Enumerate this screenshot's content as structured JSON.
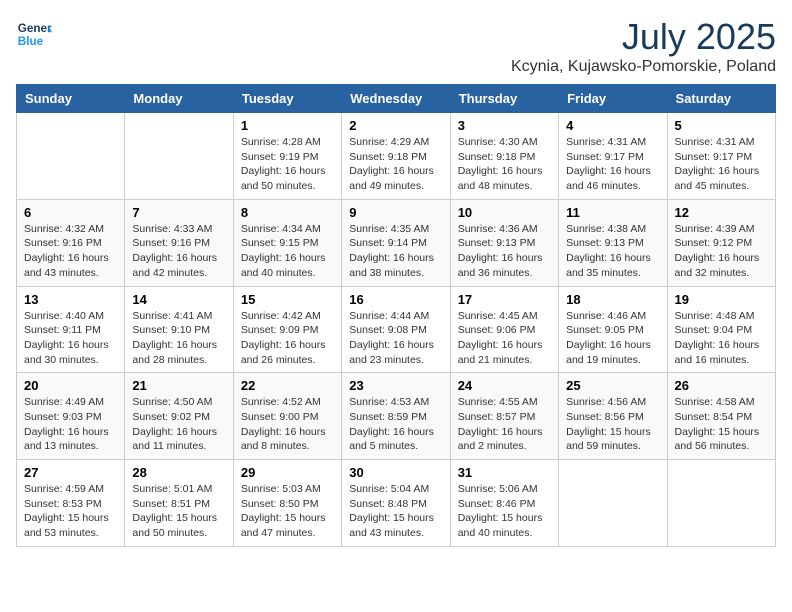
{
  "header": {
    "logo_line1": "General",
    "logo_line2": "Blue",
    "month": "July 2025",
    "location": "Kcynia, Kujawsko-Pomorskie, Poland"
  },
  "days_of_week": [
    "Sunday",
    "Monday",
    "Tuesday",
    "Wednesday",
    "Thursday",
    "Friday",
    "Saturday"
  ],
  "weeks": [
    [
      {
        "day": "",
        "info": ""
      },
      {
        "day": "",
        "info": ""
      },
      {
        "day": "1",
        "info": "Sunrise: 4:28 AM\nSunset: 9:19 PM\nDaylight: 16 hours\nand 50 minutes."
      },
      {
        "day": "2",
        "info": "Sunrise: 4:29 AM\nSunset: 9:18 PM\nDaylight: 16 hours\nand 49 minutes."
      },
      {
        "day": "3",
        "info": "Sunrise: 4:30 AM\nSunset: 9:18 PM\nDaylight: 16 hours\nand 48 minutes."
      },
      {
        "day": "4",
        "info": "Sunrise: 4:31 AM\nSunset: 9:17 PM\nDaylight: 16 hours\nand 46 minutes."
      },
      {
        "day": "5",
        "info": "Sunrise: 4:31 AM\nSunset: 9:17 PM\nDaylight: 16 hours\nand 45 minutes."
      }
    ],
    [
      {
        "day": "6",
        "info": "Sunrise: 4:32 AM\nSunset: 9:16 PM\nDaylight: 16 hours\nand 43 minutes."
      },
      {
        "day": "7",
        "info": "Sunrise: 4:33 AM\nSunset: 9:16 PM\nDaylight: 16 hours\nand 42 minutes."
      },
      {
        "day": "8",
        "info": "Sunrise: 4:34 AM\nSunset: 9:15 PM\nDaylight: 16 hours\nand 40 minutes."
      },
      {
        "day": "9",
        "info": "Sunrise: 4:35 AM\nSunset: 9:14 PM\nDaylight: 16 hours\nand 38 minutes."
      },
      {
        "day": "10",
        "info": "Sunrise: 4:36 AM\nSunset: 9:13 PM\nDaylight: 16 hours\nand 36 minutes."
      },
      {
        "day": "11",
        "info": "Sunrise: 4:38 AM\nSunset: 9:13 PM\nDaylight: 16 hours\nand 35 minutes."
      },
      {
        "day": "12",
        "info": "Sunrise: 4:39 AM\nSunset: 9:12 PM\nDaylight: 16 hours\nand 32 minutes."
      }
    ],
    [
      {
        "day": "13",
        "info": "Sunrise: 4:40 AM\nSunset: 9:11 PM\nDaylight: 16 hours\nand 30 minutes."
      },
      {
        "day": "14",
        "info": "Sunrise: 4:41 AM\nSunset: 9:10 PM\nDaylight: 16 hours\nand 28 minutes."
      },
      {
        "day": "15",
        "info": "Sunrise: 4:42 AM\nSunset: 9:09 PM\nDaylight: 16 hours\nand 26 minutes."
      },
      {
        "day": "16",
        "info": "Sunrise: 4:44 AM\nSunset: 9:08 PM\nDaylight: 16 hours\nand 23 minutes."
      },
      {
        "day": "17",
        "info": "Sunrise: 4:45 AM\nSunset: 9:06 PM\nDaylight: 16 hours\nand 21 minutes."
      },
      {
        "day": "18",
        "info": "Sunrise: 4:46 AM\nSunset: 9:05 PM\nDaylight: 16 hours\nand 19 minutes."
      },
      {
        "day": "19",
        "info": "Sunrise: 4:48 AM\nSunset: 9:04 PM\nDaylight: 16 hours\nand 16 minutes."
      }
    ],
    [
      {
        "day": "20",
        "info": "Sunrise: 4:49 AM\nSunset: 9:03 PM\nDaylight: 16 hours\nand 13 minutes."
      },
      {
        "day": "21",
        "info": "Sunrise: 4:50 AM\nSunset: 9:02 PM\nDaylight: 16 hours\nand 11 minutes."
      },
      {
        "day": "22",
        "info": "Sunrise: 4:52 AM\nSunset: 9:00 PM\nDaylight: 16 hours\nand 8 minutes."
      },
      {
        "day": "23",
        "info": "Sunrise: 4:53 AM\nSunset: 8:59 PM\nDaylight: 16 hours\nand 5 minutes."
      },
      {
        "day": "24",
        "info": "Sunrise: 4:55 AM\nSunset: 8:57 PM\nDaylight: 16 hours\nand 2 minutes."
      },
      {
        "day": "25",
        "info": "Sunrise: 4:56 AM\nSunset: 8:56 PM\nDaylight: 15 hours\nand 59 minutes."
      },
      {
        "day": "26",
        "info": "Sunrise: 4:58 AM\nSunset: 8:54 PM\nDaylight: 15 hours\nand 56 minutes."
      }
    ],
    [
      {
        "day": "27",
        "info": "Sunrise: 4:59 AM\nSunset: 8:53 PM\nDaylight: 15 hours\nand 53 minutes."
      },
      {
        "day": "28",
        "info": "Sunrise: 5:01 AM\nSunset: 8:51 PM\nDaylight: 15 hours\nand 50 minutes."
      },
      {
        "day": "29",
        "info": "Sunrise: 5:03 AM\nSunset: 8:50 PM\nDaylight: 15 hours\nand 47 minutes."
      },
      {
        "day": "30",
        "info": "Sunrise: 5:04 AM\nSunset: 8:48 PM\nDaylight: 15 hours\nand 43 minutes."
      },
      {
        "day": "31",
        "info": "Sunrise: 5:06 AM\nSunset: 8:46 PM\nDaylight: 15 hours\nand 40 minutes."
      },
      {
        "day": "",
        "info": ""
      },
      {
        "day": "",
        "info": ""
      }
    ]
  ]
}
